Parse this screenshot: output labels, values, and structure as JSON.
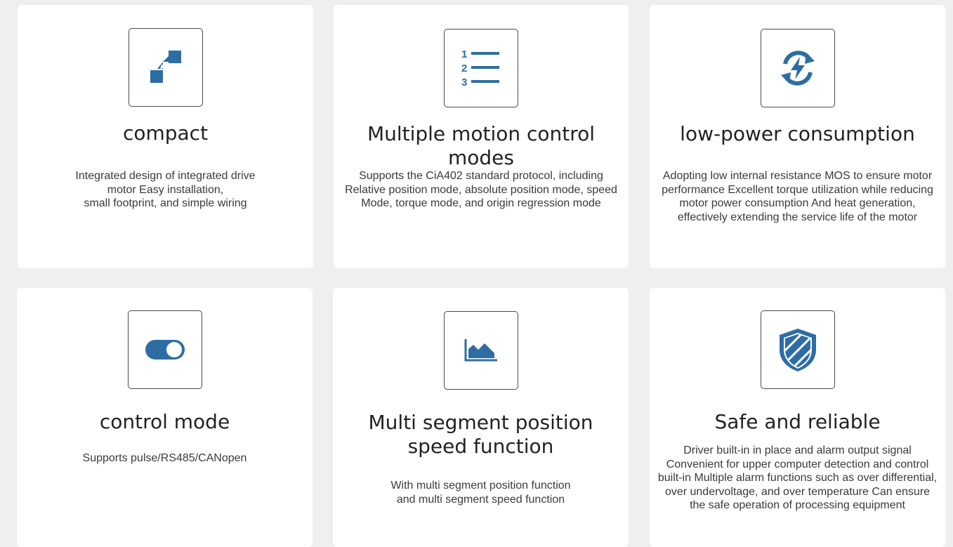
{
  "colors": {
    "background": "#efefef",
    "card": "#ffffff",
    "icon_accent": "#2e6da4",
    "icon_border": "#4a4a4a",
    "title_text": "#222222",
    "body_text": "#3a3a3a"
  },
  "features": [
    {
      "icon": "compact-arrows-icon",
      "title": "compact",
      "description": "Integrated design of integrated drive\nmotor Easy installation,\nsmall footprint, and simple wiring"
    },
    {
      "icon": "numbered-list-icon",
      "title": "Multiple motion control modes",
      "description": "Supports the CiA402 standard protocol, including\nRelative position mode, absolute position mode, speed\nMode, torque mode, and origin regression mode"
    },
    {
      "icon": "power-cycle-icon",
      "title": "low-power consumption",
      "description": "Adopting low internal resistance MOS to ensure motor\nperformance Excellent torque utilization while reducing\nmotor power consumption And heat generation,\neffectively extending the service life of the motor"
    },
    {
      "icon": "toggle-switch-icon",
      "title": "control mode",
      "description": "Supports pulse/RS485/CANopen"
    },
    {
      "icon": "area-chart-icon",
      "title": "Multi segment position\nspeed function",
      "description": "With multi segment position function\nand multi segment speed function"
    },
    {
      "icon": "shield-icon",
      "title": "Safe and reliable",
      "description": "Driver built-in in place and alarm output signal\nConvenient for upper computer detection and control\nbuilt-in Multiple alarm functions such as over differential,\nover undervoltage, and over temperature Can ensure\nthe safe operation of processing equipment"
    }
  ]
}
